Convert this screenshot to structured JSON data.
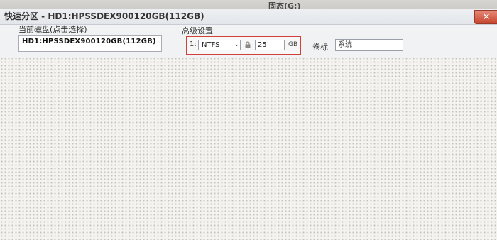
{
  "window": {
    "drive_label": "固态(G:)",
    "title": "快速分区 - HD1:HPSSDEX900120GB(112GB)",
    "close_glyph": "✕"
  },
  "disk_panel": {
    "label": "当前磁盘(点击选择)",
    "selected_disk": "HD1:HPSSDEX900120GB(112GB)"
  },
  "advanced": {
    "label": "高级设置",
    "row_index": "1:",
    "filesystem": "NTFS",
    "size_value": "25",
    "size_unit": "GB",
    "volume_label_caption": "卷标",
    "volume_label_value": "系统"
  },
  "icons": {
    "close": "close-icon",
    "dropdown": "chevron-down-icon",
    "lock": "lock-icon"
  },
  "colors": {
    "highlight_border": "#d2403a",
    "close_button": "#c8452e"
  }
}
